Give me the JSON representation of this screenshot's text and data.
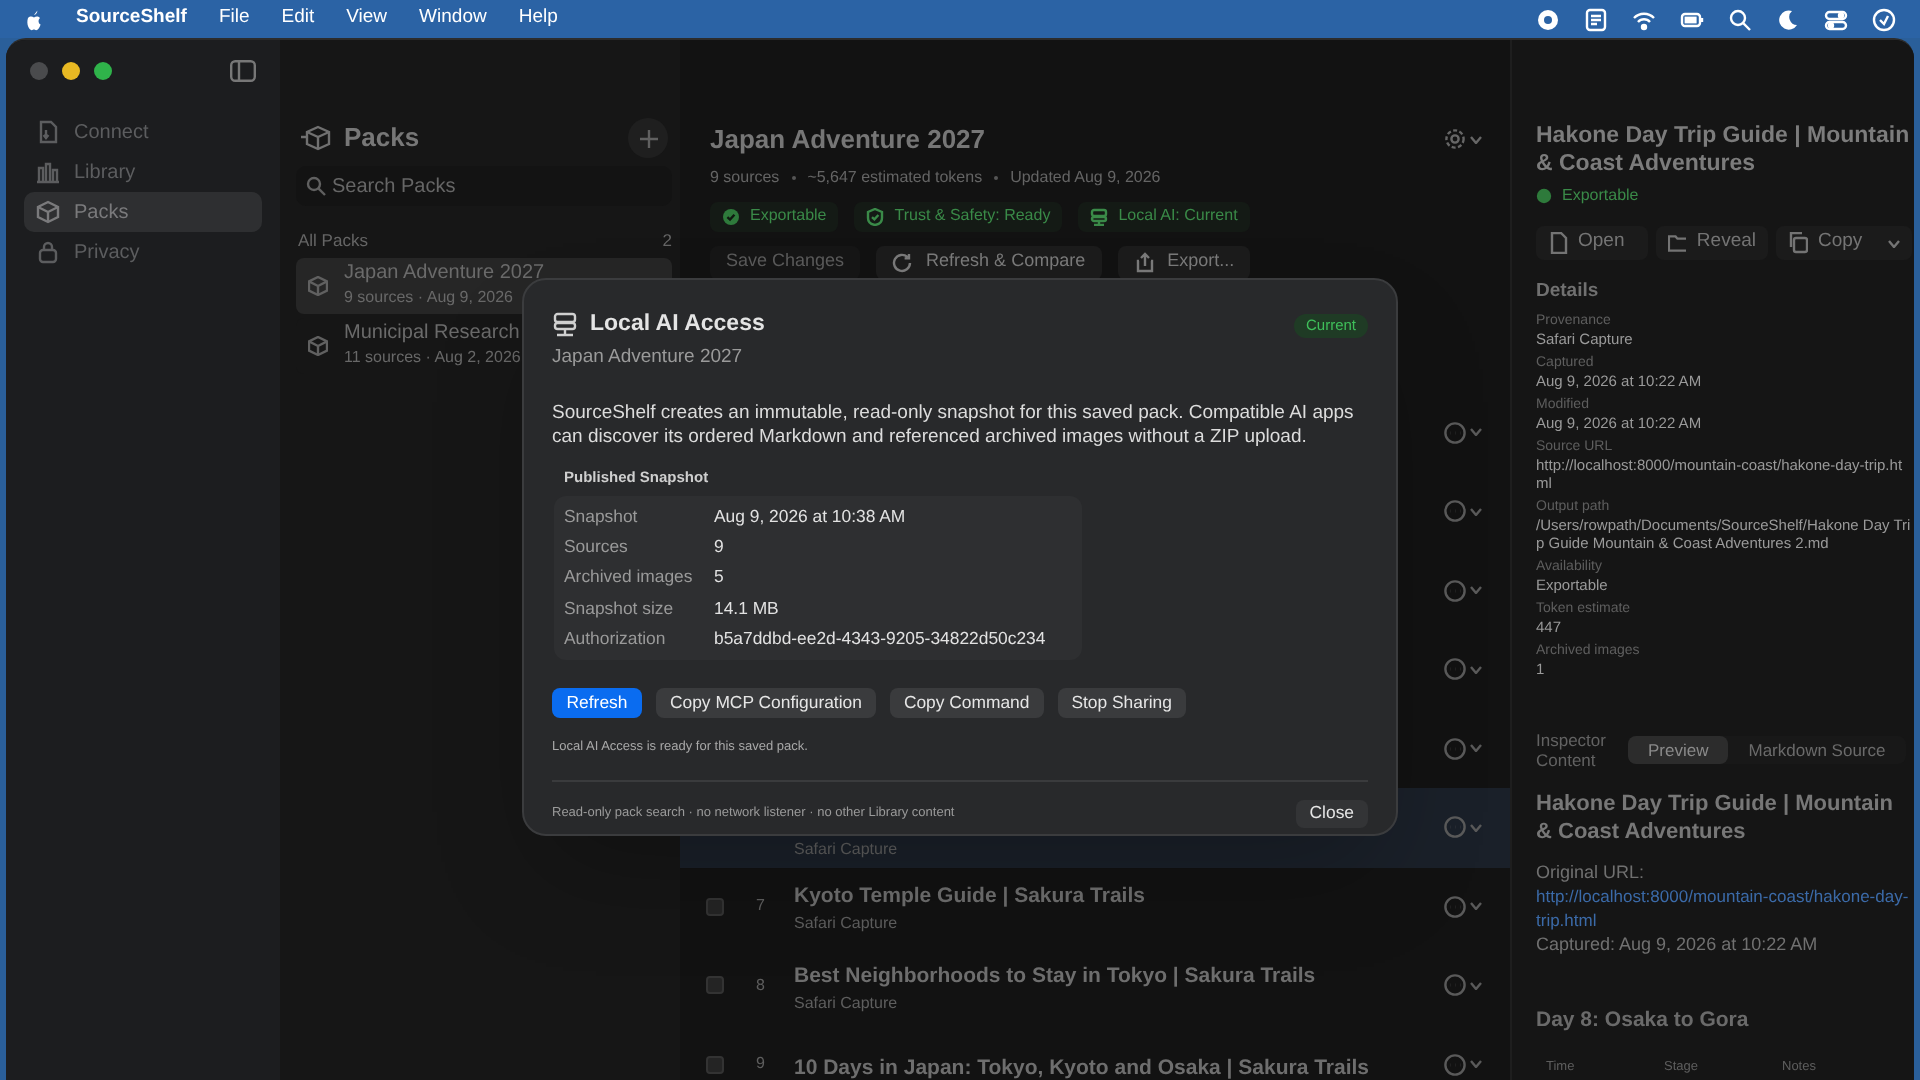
{
  "menu_bar": {
    "app_name": "SourceShelf",
    "items": [
      "File",
      "Edit",
      "View",
      "Window",
      "Help"
    ]
  },
  "sidebar": {
    "items": [
      {
        "label": "Connect",
        "selected": false
      },
      {
        "label": "Library",
        "selected": false
      },
      {
        "label": "Packs",
        "selected": true
      },
      {
        "label": "Privacy",
        "selected": false
      }
    ]
  },
  "packs": {
    "title": "Packs",
    "search": {
      "placeholder": "Search Packs"
    },
    "section": "All Packs",
    "count": "2",
    "items": [
      {
        "name": "Japan Adventure 2027",
        "meta": "9 sources · Aug 9, 2026",
        "selected": true
      },
      {
        "name": "Municipal Research",
        "meta": "11 sources · Aug 2, 2026",
        "selected": false
      }
    ]
  },
  "main": {
    "title": "Japan Adventure 2027",
    "meta": [
      "9 sources",
      "~5,647 estimated tokens",
      "Updated Aug 9, 2026"
    ],
    "badges": [
      "Exportable",
      "Trust & Safety: Ready",
      "Local AI: Current"
    ],
    "actions": [
      {
        "label": "Save Changes",
        "disabled": true
      },
      {
        "label": "Refresh & Compare",
        "disabled": false
      },
      {
        "label": "Export...",
        "disabled": false
      }
    ],
    "rows": [
      {
        "selected": false
      },
      {
        "selected": false
      },
      {
        "selected": false
      },
      {
        "selected": false
      },
      {
        "selected": false
      },
      {
        "subtitle": "Safari Capture",
        "selected": true
      },
      {
        "number": "7",
        "title": "Kyoto Temple Guide | Sakura Trails",
        "subtitle": "Safari Capture",
        "checked": false,
        "selected": false
      },
      {
        "number": "8",
        "title": "Best Neighborhoods to Stay in Tokyo | Sakura Trails",
        "subtitle": "Safari Capture",
        "checked": false,
        "selected": false
      },
      {
        "number": "9",
        "title": "10 Days in Japan: Tokyo, Kyoto and Osaka | Sakura Trails",
        "checked": false,
        "selected": false
      }
    ]
  },
  "inspector": {
    "title": "Hakone Day Trip Guide | Mountain & Coast Adventures",
    "status": "Exportable",
    "actions": [
      "Open",
      "Reveal",
      "Copy"
    ],
    "details_heading": "Details",
    "fields": [
      {
        "label": "Provenance",
        "value": "Safari Capture"
      },
      {
        "label": "Captured",
        "value": "Aug 9, 2026 at 10:22 AM"
      },
      {
        "label": "Modified",
        "value": "Aug 9, 2026 at 10:22 AM"
      },
      {
        "label": "Source URL",
        "value": "http://localhost:8000/mountain-coast/hakone-day-trip.html"
      },
      {
        "label": "Output path",
        "value": "/Users/rowpath/Documents/SourceShelf/Hakone Day Trip Guide Mountain & Coast Adventures 2.md"
      },
      {
        "label": "Availability",
        "value": "Exportable"
      },
      {
        "label": "Token estimate",
        "value": "447"
      },
      {
        "label": "Archived images",
        "value": "1"
      }
    ],
    "content_label": "Inspector Content",
    "tabs": [
      {
        "label": "Preview",
        "selected": true
      },
      {
        "label": "Markdown Source",
        "selected": false
      }
    ],
    "preview": {
      "title": "Hakone Day Trip Guide | Mountain & Coast Adventures",
      "url_label": "Original URL:",
      "url": "http://localhost:8000/mountain-coast/hakone-day-trip.html",
      "captured": "Captured: Aug 9, 2026 at 10:22 AM",
      "heading": "Day 8: Osaka to Gora",
      "columns": [
        "Time",
        "Stage",
        "Notes"
      ]
    }
  },
  "dialog": {
    "title": "Local AI Access",
    "subtitle": "Japan Adventure 2027",
    "badge": "Current",
    "description": "SourceShelf creates an immutable, read-only snapshot for this saved pack. Compatible AI apps can discover its ordered Markdown and referenced archived images without a ZIP upload.",
    "section": "Published Snapshot",
    "rows": [
      {
        "label": "Snapshot",
        "value": "Aug 9, 2026 at 10:38 AM"
      },
      {
        "label": "Sources",
        "value": "9"
      },
      {
        "label": "Archived images",
        "value": "5"
      },
      {
        "label": "Snapshot size",
        "value": "14.1 MB"
      },
      {
        "label": "Authorization",
        "value": "b5a7ddbd-ee2d-4343-9205-34822d50c234"
      }
    ],
    "buttons": [
      {
        "label": "Refresh",
        "primary": true
      },
      {
        "label": "Copy MCP Configuration",
        "primary": false
      },
      {
        "label": "Copy Command",
        "primary": false
      },
      {
        "label": "Stop Sharing",
        "primary": false
      }
    ],
    "status": "Local AI Access is ready for this saved pack.",
    "footer": "Read-only pack search · no network listener · no other Library content",
    "close": "Close"
  }
}
